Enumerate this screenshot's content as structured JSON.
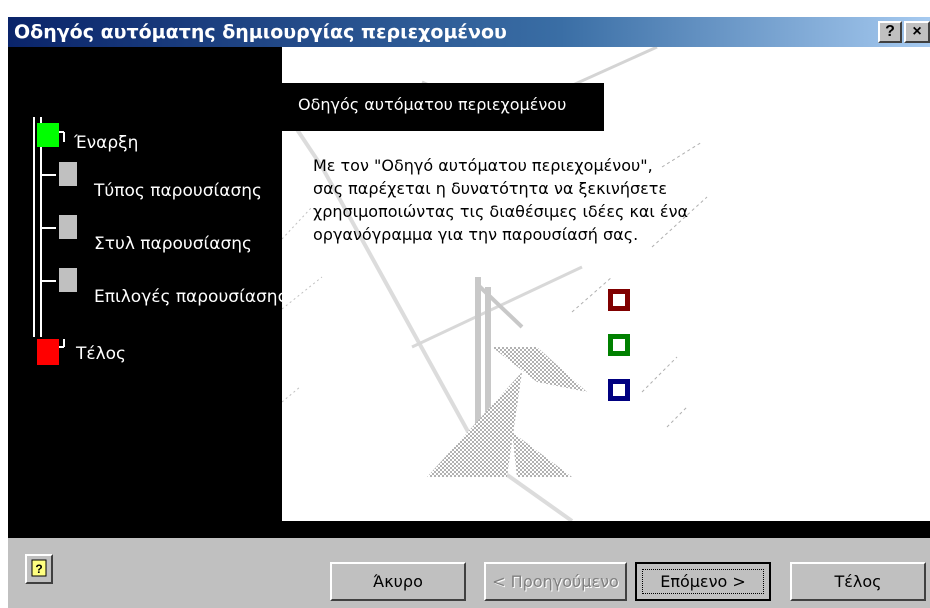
{
  "window": {
    "title": "Οδηγός αυτόματης δημιουργίας περιεχομένου",
    "help_glyph": "?",
    "close_glyph": "×"
  },
  "steps": [
    {
      "label": "Έναρξη",
      "state": "start",
      "color": "#00ff00"
    },
    {
      "label": "Τύπος παρουσίασης",
      "state": "pending",
      "color": "#c0c0c0"
    },
    {
      "label": "Στυλ παρουσίασης",
      "state": "pending",
      "color": "#c0c0c0"
    },
    {
      "label": "Επιλογές παρουσίασης",
      "state": "pending",
      "color": "#c0c0c0"
    },
    {
      "label": "Τέλος",
      "state": "end",
      "color": "#ff0000"
    }
  ],
  "content": {
    "heading": "Οδηγός αυτόματου περιεχομένου",
    "description_lines": [
      "Με τον \"Οδηγό αυτόματου περιεχομένου\",",
      "σας παρέχεται η δυνατότητα να ξεκινήσετε",
      "χρησιμοποιώντας τις διαθέσιμες ιδέες και ένα",
      "οργανόγραμμα για την παρουσίασή σας."
    ],
    "squares": [
      "#800000",
      "#008000",
      "#000080"
    ]
  },
  "buttons": {
    "help_icon": "help-icon",
    "cancel": "Άκυρο",
    "back": "< Προηγούμενο",
    "next": "Επόμενο >",
    "finish": "Τέλος"
  }
}
